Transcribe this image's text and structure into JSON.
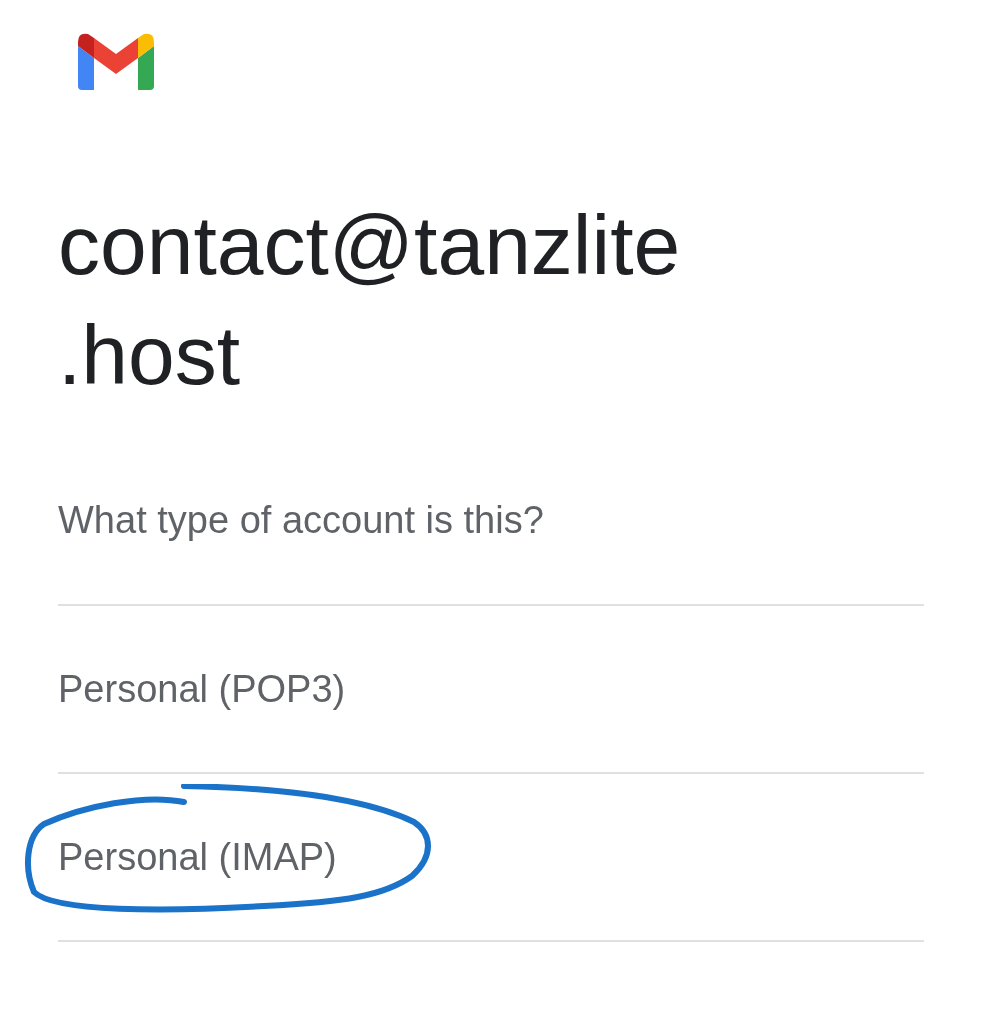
{
  "account": {
    "email_lines": [
      "contact@tanzlite",
      ".host"
    ]
  },
  "question": "What type of account is this?",
  "options": [
    {
      "label": "Personal (POP3)",
      "circled": false
    },
    {
      "label": "Personal (IMAP)",
      "circled": true
    }
  ]
}
